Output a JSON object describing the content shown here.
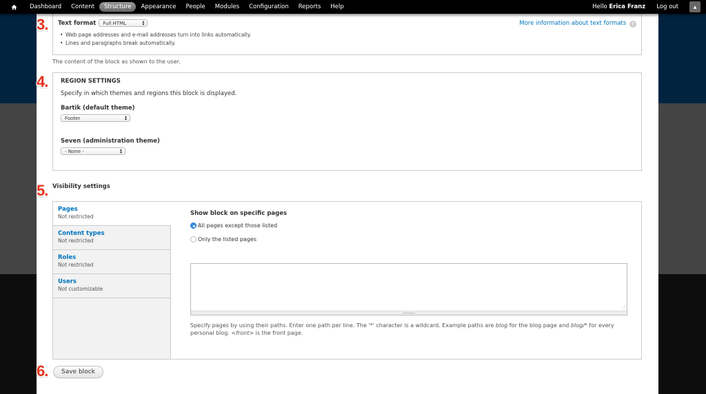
{
  "toolbar": {
    "home_icon": "home-icon",
    "menu": [
      {
        "label": "Dashboard",
        "active": false
      },
      {
        "label": "Content",
        "active": false
      },
      {
        "label": "Structure",
        "active": true
      },
      {
        "label": "Appearance",
        "active": false
      },
      {
        "label": "People",
        "active": false
      },
      {
        "label": "Modules",
        "active": false
      },
      {
        "label": "Configuration",
        "active": false
      },
      {
        "label": "Reports",
        "active": false
      },
      {
        "label": "Help",
        "active": false
      }
    ],
    "hello_prefix": "Hello",
    "user_name": "Erica Franz",
    "logout": "Log out",
    "toggle_icon": "triangle-up-icon"
  },
  "markers": {
    "m3": "3.",
    "m4": "4.",
    "m5": "5.",
    "m6": "6."
  },
  "text_format": {
    "label": "Text format",
    "selected": "Full HTML",
    "more_info": "More information about text formats",
    "tips": [
      "Web page addresses and e-mail addresses turn into links automatically.",
      "Lines and paragraphs break automatically."
    ],
    "body_description": "The content of the block as shown to the user."
  },
  "region_settings": {
    "title": "REGION SETTINGS",
    "description": "Specify in which themes and regions this block is displayed.",
    "themes": [
      {
        "label": "Bartik (default theme)",
        "selected": "Footer"
      },
      {
        "label": "Seven (administration theme)",
        "selected": "- None -"
      }
    ]
  },
  "visibility": {
    "title": "Visibility settings",
    "tabs": [
      {
        "title": "Pages",
        "summary": "Not restricted",
        "selected": true
      },
      {
        "title": "Content types",
        "summary": "Not restricted",
        "selected": false
      },
      {
        "title": "Roles",
        "summary": "Not restricted",
        "selected": false
      },
      {
        "title": "Users",
        "summary": "Not customizable",
        "selected": false
      }
    ],
    "pages": {
      "heading": "Show block on specific pages",
      "options": [
        {
          "label": "All pages except those listed",
          "checked": true
        },
        {
          "label": "Only the listed pages",
          "checked": false
        }
      ],
      "textarea_value": "",
      "help_part1": "Specify pages by using their paths. Enter one path per line. The '*' character is a wildcard. Example paths are ",
      "help_em1": "blog",
      "help_part2": " for the blog page and ",
      "help_em2": "blog/*",
      "help_part3": " for every personal blog. ",
      "help_em3": "<front>",
      "help_part4": " is the front page."
    }
  },
  "actions": {
    "save": "Save block"
  }
}
